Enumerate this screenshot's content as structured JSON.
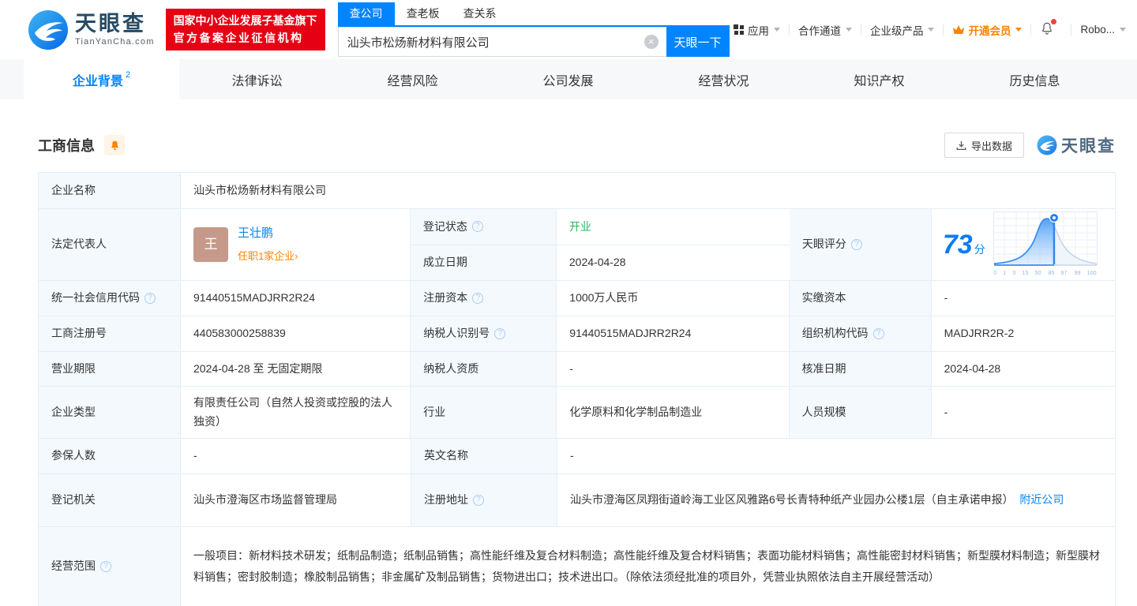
{
  "header": {
    "logo": {
      "brand": "天眼查",
      "domain": "TianYanCha.com"
    },
    "badge": {
      "line1": "国家中小企业发展子基金旗下",
      "line2": "官方备案企业征信机构"
    },
    "search": {
      "tab_company": "查公司",
      "tab_boss": "查老板",
      "tab_relation": "查关系",
      "value": "汕头市松炀新材料有限公司",
      "button": "天眼一下"
    },
    "nav": {
      "apps": "应用",
      "partner": "合作通道",
      "enterprise": "企业级产品",
      "vip": "开通会员",
      "user": "Robo..."
    }
  },
  "tabs": [
    {
      "label": "企业背景",
      "badge": "2",
      "active": true
    },
    {
      "label": "法律诉讼",
      "active": false
    },
    {
      "label": "经营风险",
      "active": false
    },
    {
      "label": "公司发展",
      "active": false
    },
    {
      "label": "经营状况",
      "active": false
    },
    {
      "label": "知识产权",
      "active": false
    },
    {
      "label": "历史信息",
      "active": false
    }
  ],
  "section": {
    "title": "工商信息",
    "export_label": "导出数据",
    "watermark": "天眼查"
  },
  "fields": {
    "company_name": {
      "label": "企业名称",
      "value": "汕头市松炀新材料有限公司"
    },
    "legal_rep": {
      "label": "法定代表人",
      "name": "王壮鹏",
      "avatar": "王",
      "link": "任职1家企业",
      "link_arrow": "›"
    },
    "reg_status": {
      "label": "登记状态",
      "value": "开业"
    },
    "establish_date": {
      "label": "成立日期",
      "value": "2024-04-28"
    },
    "tyc_score": {
      "label": "天眼评分",
      "value": "73",
      "unit": "分",
      "chart": {
        "type": "area",
        "x_labels": [
          "0",
          "1",
          "3",
          "15",
          "50",
          "85",
          "97",
          "99",
          "100"
        ],
        "marker_value": 73
      }
    },
    "credit_code": {
      "label": "统一社会信用代码",
      "value": "91440515MADJRR2R24"
    },
    "reg_capital": {
      "label": "注册资本",
      "value": "1000万人民币"
    },
    "paid_capital": {
      "label": "实缴资本",
      "value": "-"
    },
    "reg_number": {
      "label": "工商注册号",
      "value": "440583000258839"
    },
    "taxpayer_id": {
      "label": "纳税人识别号",
      "value": "91440515MADJRR2R24"
    },
    "org_code": {
      "label": "组织机构代码",
      "value": "MADJRR2R-2"
    },
    "business_term": {
      "label": "营业期限",
      "value": "2024-04-28 至 无固定期限"
    },
    "taxpayer_quals": {
      "label": "纳税人资质",
      "value": "-"
    },
    "approval_date": {
      "label": "核准日期",
      "value": "2024-04-28"
    },
    "company_type": {
      "label": "企业类型",
      "value": "有限责任公司（自然人投资或控股的法人独资）"
    },
    "industry": {
      "label": "行业",
      "value": "化学原料和化学制品制造业"
    },
    "staff_size": {
      "label": "人员规模",
      "value": "-"
    },
    "insured_count": {
      "label": "参保人数",
      "value": "-"
    },
    "english_name": {
      "label": "英文名称",
      "value": "-"
    },
    "reg_authority": {
      "label": "登记机关",
      "value": "汕头市澄海区市场监督管理局"
    },
    "reg_address": {
      "label": "注册地址",
      "value": "汕头市澄海区凤翔街道岭海工业区风雅路6号长青特种纸产业园办公楼1层（自主承诺申报）",
      "link": "附近公司"
    },
    "business_scope": {
      "label": "经营范围",
      "value": "一般项目：新材料技术研发；纸制品制造；纸制品销售；高性能纤维及复合材料制造；高性能纤维及复合材料销售；表面功能材料销售；高性能密封材料销售；新型膜材料制造；新型膜材料销售；密封胶制造；橡胶制品销售；非金属矿及制品销售；货物进出口；技术进出口。（除依法须经批准的项目外，凭营业执照依法自主开展经营活动）"
    }
  },
  "colors": {
    "accent": "#0084ff",
    "brand_red": "#e60014",
    "vip_orange": "#ff8200",
    "status_green": "#2bb55f"
  }
}
